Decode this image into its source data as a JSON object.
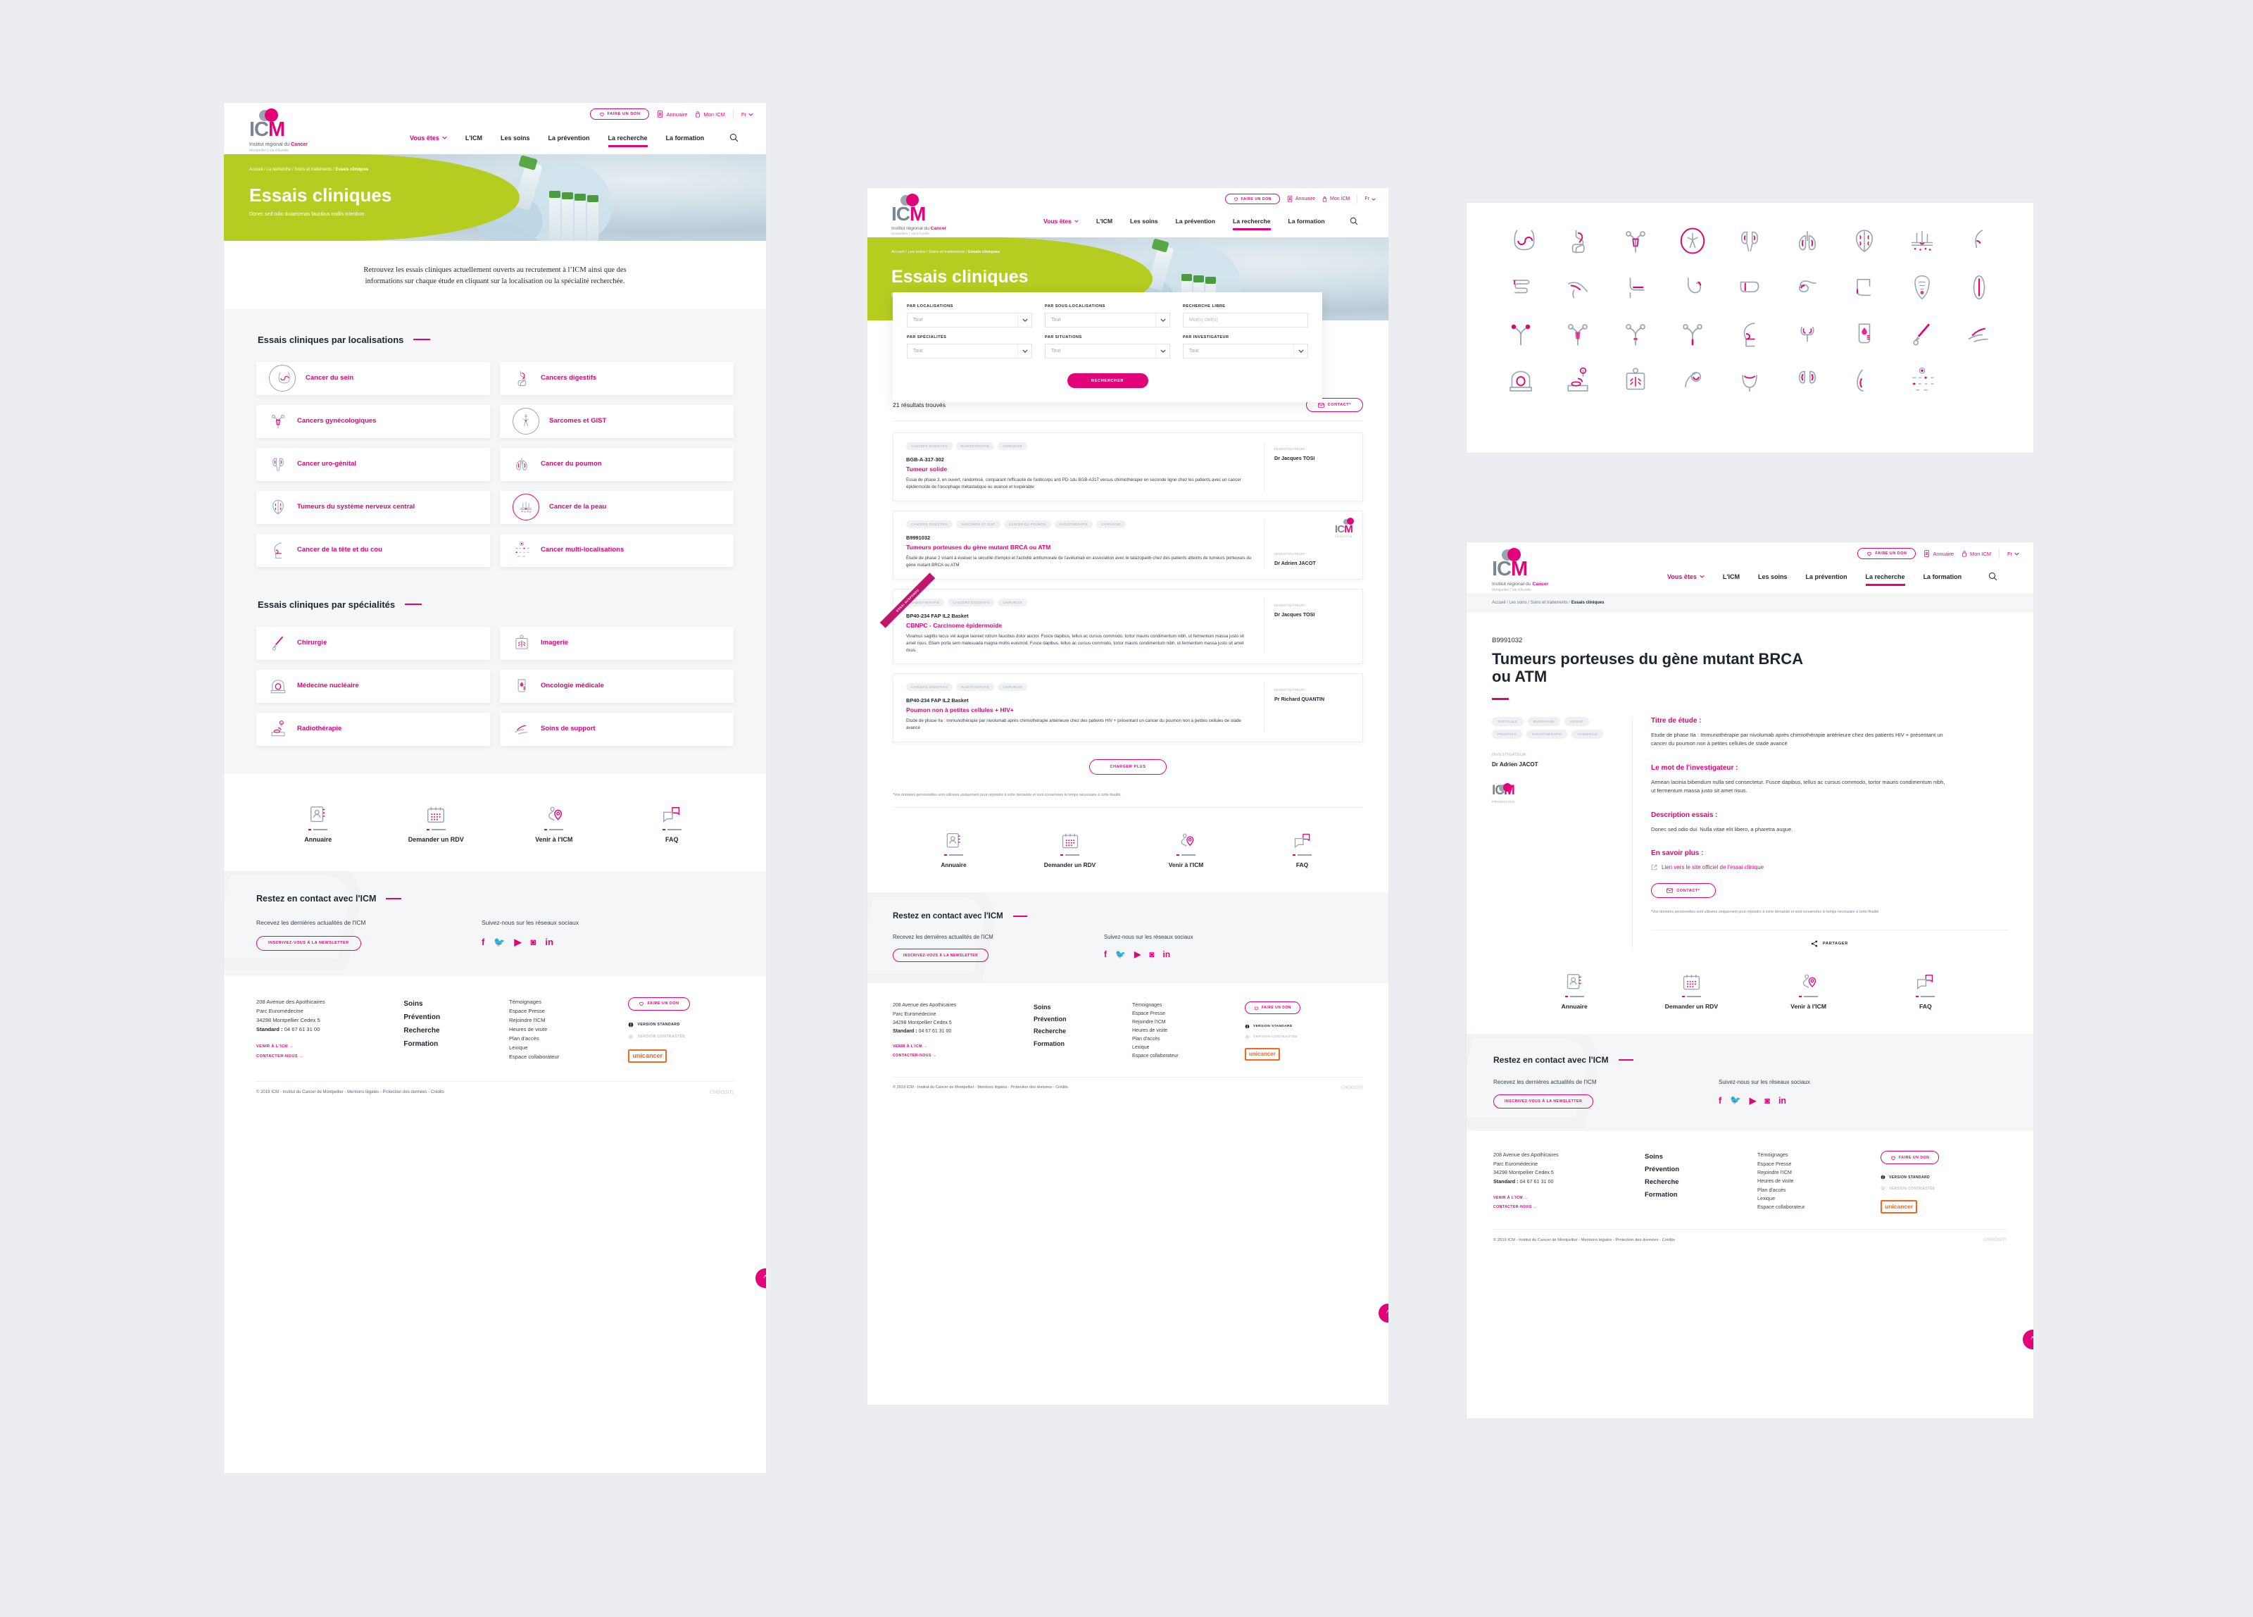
{
  "brand": {
    "logo_text": "ICM",
    "logo_tagline_prefix": "Institut régional du ",
    "logo_tagline_accent": "Cancer",
    "logo_tagline2": "Montpellier | Val d'Aurelle",
    "accent": "#e2037a",
    "green": "#b5cc20",
    "orange": "#f26722"
  },
  "header": {
    "donate": "FAIRE UN DON",
    "annuaire": "Annuaire",
    "mon_icm": "Mon ICM",
    "lang": "Fr",
    "nav": [
      {
        "label": "Vous êtes",
        "style": "pink",
        "caret": true
      },
      {
        "label": "L'ICM"
      },
      {
        "label": "Les soins"
      },
      {
        "label": "La prévention"
      },
      {
        "label": "La recherche",
        "active": true
      },
      {
        "label": "La formation"
      }
    ]
  },
  "panel1": {
    "breadcrumb": [
      "Accueil",
      "La recherche",
      "Soins et traitements",
      "Essais cliniques"
    ],
    "hero_title": "Essais cliniques",
    "hero_sub": "Donec sed odio duiaecenas faucibus mollis interdum.",
    "intro": "Retrouvez les essais cliniques actuellement ouverts au recrutement à l’ICM ainsi que des informations sur chaque étude en cliquant sur la localisation ou la spécialité recherchée.",
    "section_localisations": "Essais cliniques par localisations",
    "section_specialites": "Essais cliniques par spécialités",
    "localisations": [
      {
        "label": "Cancer du sein",
        "icon": "breast-icon",
        "circled": true
      },
      {
        "label": "Cancers digestifs",
        "icon": "digestive-icon"
      },
      {
        "label": "Cancers gynécologiques",
        "icon": "uterus-icon"
      },
      {
        "label": "Sarcomes et GIST",
        "icon": "sarcoma-icon",
        "circled": true
      },
      {
        "label": "Cancer uro-génital",
        "icon": "kidneys-icon"
      },
      {
        "label": "Cancer du poumon",
        "icon": "lungs-icon"
      },
      {
        "label": "Tumeurs du système nerveux central",
        "icon": "brain-icon"
      },
      {
        "label": "Cancer de la peau",
        "icon": "skin-icon",
        "circled": true
      },
      {
        "label": "Cancer de la tête et du cou",
        "icon": "head-neck-icon"
      },
      {
        "label": "Cancer multi-localisations",
        "icon": "multi-organs-icon"
      }
    ],
    "specialites": [
      {
        "label": "Chirurgie",
        "icon": "scalpel-icon"
      },
      {
        "label": "Imagerie",
        "icon": "xray-icon"
      },
      {
        "label": "Médecine nucléaire",
        "icon": "scanner-icon"
      },
      {
        "label": "Oncologie médicale",
        "icon": "iv-bag-icon"
      },
      {
        "label": "Radiothérapie",
        "icon": "radiotherapy-icon"
      },
      {
        "label": "Soins de support",
        "icon": "hands-care-icon"
      }
    ]
  },
  "quicklinks": [
    {
      "label": "Annuaire",
      "icon": "directory-icon"
    },
    {
      "label": "Demander un RDV",
      "icon": "calendar-icon"
    },
    {
      "label": "Venir à l'ICM",
      "icon": "map-pin-icon"
    },
    {
      "label": "FAQ",
      "icon": "chat-bubbles-icon"
    }
  ],
  "keep_in_touch": {
    "title": "Restez en contact avec l'ICM",
    "newsletter_text": "Recevez les dernières actualités de l'ICM",
    "newsletter_button": "INSCRIVEZ-VOUS À LA NEWSLETTER",
    "social_text": "Suivez-nous sur les réseaux sociaux",
    "socials": [
      "facebook-icon",
      "twitter-icon",
      "youtube-icon",
      "instagram-icon",
      "linkedin-icon"
    ]
  },
  "footer": {
    "address": [
      "208 Avenue des Apothicaires",
      "Parc Euromédecine",
      "34298 Montpellier Cedex 5"
    ],
    "standard_label": "Standard :",
    "standard_value": "04 67 61 31 00",
    "link_venir": "VENIR À L'ICM",
    "link_contact": "CONTACTER-NOUS",
    "main_links": [
      "Soins",
      "Prévention",
      "Recherche",
      "Formation"
    ],
    "sec_links": [
      "Témoignages",
      "Espace Presse",
      "Rejoindre l'ICM",
      "Heures de visite",
      "Plan d'accès",
      "Lexique",
      "Espace collaborateur"
    ],
    "donate": "FAIRE UN DON",
    "version_standard": "VERSION STANDARD",
    "version_contrast": "VERSION CONTRASTÉE",
    "unicancer": "unicancer",
    "copyright": "© 2019 ICM - Institut du Cancer de Montpellier - Mentions légales - Protection des données - Crédits",
    "choosit": "CHOOSIT!"
  },
  "panel2": {
    "breadcrumb": [
      "Accueil",
      "Les soins",
      "Soins et traitements",
      "Essais cliniques"
    ],
    "hero_title": "Essais cliniques",
    "hero_sub": "Donec sed odio duiaecenas faucibus mollis interdum.",
    "form": {
      "fields": [
        {
          "label": "PAR LOCALISATIONS",
          "type": "select",
          "value": "Tout"
        },
        {
          "label": "PAR SOUS-LOCALISATIONS",
          "type": "select",
          "value": "Tout"
        },
        {
          "label": "RECHERCHE LIBRE",
          "type": "input",
          "placeholder": "Mot(s) clef(s)"
        },
        {
          "label": "PAR SPÉCIALITÉS",
          "type": "select",
          "value": "Tout"
        },
        {
          "label": "PAR SITUATIONS",
          "type": "select",
          "value": "Tout"
        },
        {
          "label": "PAR INVESTIGATEUR",
          "type": "select",
          "value": "Tout"
        }
      ],
      "submit": "RECHERCHER"
    },
    "results_count": "21 résultats trouvés",
    "contact_button": "CONTACT*",
    "investigator_label": "INVESTIGATEUR :",
    "results": [
      {
        "tags": [
          "CANCERS DIGESTIFS",
          "RADIOTHÉRAPIE",
          "CHIRURGIE"
        ],
        "code": "BGB-A-317-302",
        "title": "Tumeur solide",
        "desc": "Essai de phase 3, en ouvert, randomisé, comparant l'efficacité de l'anticorps anti PD-1du BGB-A317 versus chimiothérapie en seconde ligne chez les patients avec un cancer épidermoïde de l'œsophage métastatique ou avancé et inopérable",
        "investigator": "Dr Jacques TOSI",
        "promo_logo": false,
        "ribbon": null
      },
      {
        "tags": [
          "CANCERS DIGESTIFS",
          "SARCOMES ET GIST",
          "CANCER DU POUMON",
          "RADIOTHÉRAPIE",
          "CHIRURGIE"
        ],
        "code": "B9991032",
        "title": "Tumeurs porteuses du gène mutant BRCA ou ATM",
        "desc": "Étude de phase 2 visant à évaluer la sécurité d'emploi et l'activité antitumorale de l'avélumab en association avec le talazoparib chez des patients atteints de tumeurs porteuses du gène mutant BRCA ou ATM",
        "investigator": "Dr Adrien JACOT",
        "promo_logo": true,
        "ribbon": null
      },
      {
        "tags": [
          "RADIOTHÉRAPIE",
          "CANCERS DIGESTIFS",
          "CHIRURGIE"
        ],
        "code": "BP40-234 FAP IL2 Basket",
        "title": "CBNPC - Carcinome épidermoïde",
        "desc": "Vivamus sagittis lacus vel augue laoreet rutrum faucibus dolor auctor. Fusce dapibus, tellus ac cursus commodo, tortor mauris condimentum nibh, ut fermentum massa justo sit amet risus. Etiam porta sem malesuada magna mollis euismod. Fusce dapibus, tellus ac cursus commodo, tortor mauris condimentum nibh, ut fermentum massa justo sit amet risus.",
        "investigator": "Dr Jacques TOSI",
        "promo_logo": false,
        "ribbon": "ESSAI SUSPENDU"
      },
      {
        "tags": [
          "CANCERS DIGESTIFS",
          "RADIOTHÉRAPIE",
          "CHIRURGIE"
        ],
        "code": "BP40-234 FAP IL2 Basket",
        "title": "Poumon non à petites cellules + HIV+",
        "desc": "Etude de phase IIa : Immunothérapie par nivolumab après chimiothérapie antérieure chez des patients HIV + présentant un cancer du poumon non à petites cellules de stade avancé",
        "investigator": "Pr Richard QUANTIN",
        "promo_logo": false,
        "ribbon": null
      }
    ],
    "load_more": "CHARGER PLUS",
    "privacy_note": "*Vos données personnelles sont utilisées uniquement pour répondre à votre demande et sont conservées le temps nécessaire à cette finalité."
  },
  "panel3": {
    "breadcrumb": [
      "Accueil",
      "Les soins",
      "Soins et traitements",
      "Essais cliniques"
    ],
    "code": "B9991032",
    "title": "Tumeurs porteuses du gène mutant BRCA ou ATM",
    "tags": [
      "TESTICULE",
      "ŒSOPHAGE",
      "VESSIE",
      "PROSTATE",
      "RADIOTHÉRAPIE",
      "CHIRURGIE"
    ],
    "investigator_label": "INVESTIGATEUR :",
    "investigator": "Dr Adrien JACOT",
    "promo_logo_caption": "PROMOTION",
    "blocks": [
      {
        "heading": "Titre de étude :",
        "body": "Etude de phase IIa : Immunothérapie par nivolumab après chimiothérapie antérieure chez des patients HIV + présentant un cancer du poumon non à petites cellules de stade avancé"
      },
      {
        "heading": "Le mot de l'investigateur :",
        "body": "Aenean lacinia bibendum nulla sed consectetur. Fusce dapibus, tellus ac cursus commodo, tortor mauris condimentum nibh, ut fermentum massa justo sit amet risus."
      },
      {
        "heading": "Description essais :",
        "body": "Donec sed odio dui. Nulla vitae elit libero, a pharetra augue."
      }
    ],
    "more_heading": "En savoir plus :",
    "more_link": "Lien vers le site officiel de l'essai clinique",
    "contact_button": "CONTACT*",
    "privacy_note": "*Vos données personnelles sont utilisées uniquement pour répondre à votre demande et sont conservées le temps nécessaire à cette finalité.",
    "share": "PARTAGER"
  },
  "icon_panel": {
    "rows": [
      [
        "breast-icon",
        "digestive-icon",
        "uterus-icon",
        "sarcoma-circled-icon",
        "kidneys-icon",
        "lungs-icon",
        "brain-icon",
        "skin-icon",
        "nose-icon"
      ],
      [
        "colon-icon",
        "pancreas-icon",
        "rectum-icon",
        "stomach-icon",
        "liver-icon",
        "gallbladder-icon",
        "large-intestine-icon",
        "torso-organs-icon",
        "esophagus-icon"
      ],
      [
        "ovary-icon",
        "uterus2-icon",
        "cervix-icon",
        "vagina-icon",
        "head-neck-icon",
        "thyroid-icon",
        "iv-bag-icon",
        "scalpel-icon",
        "hands-care-icon"
      ],
      [
        "scanner-icon",
        "radiotherapy-icon",
        "xray-icon",
        "prostate-icon",
        "bladder-icon",
        "kidneys2-icon",
        "testicle-icon",
        "multi-organs-icon",
        "empty-icon"
      ]
    ]
  }
}
